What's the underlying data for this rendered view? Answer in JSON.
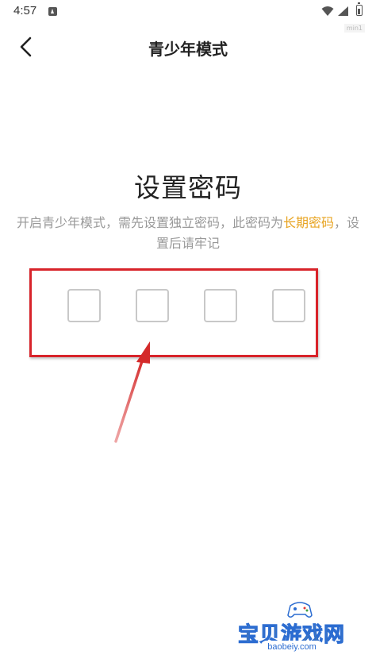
{
  "status_bar": {
    "time": "4:57",
    "app_icon": "notification-app-icon",
    "wifi_icon": "wifi-icon",
    "signal_icon": "signal-icon",
    "battery_icon": "battery-icon",
    "corner_tag": "min1"
  },
  "nav": {
    "back_icon": "chevron-left-icon",
    "title": "青少年模式"
  },
  "main": {
    "heading": "设置密码",
    "description_prefix": "开启青少年模式，需先设置独立密码，此密码为",
    "description_highlight": "长期密码",
    "description_suffix": "，设置后请牢记",
    "pin_boxes": [
      "",
      "",
      "",
      ""
    ]
  },
  "colors": {
    "highlight": "#e8a422",
    "annotation_red": "#d8232a",
    "pin_border": "#c8c8c8"
  },
  "watermark": {
    "text": "宝贝游戏网",
    "url": "baobeiy.com"
  }
}
